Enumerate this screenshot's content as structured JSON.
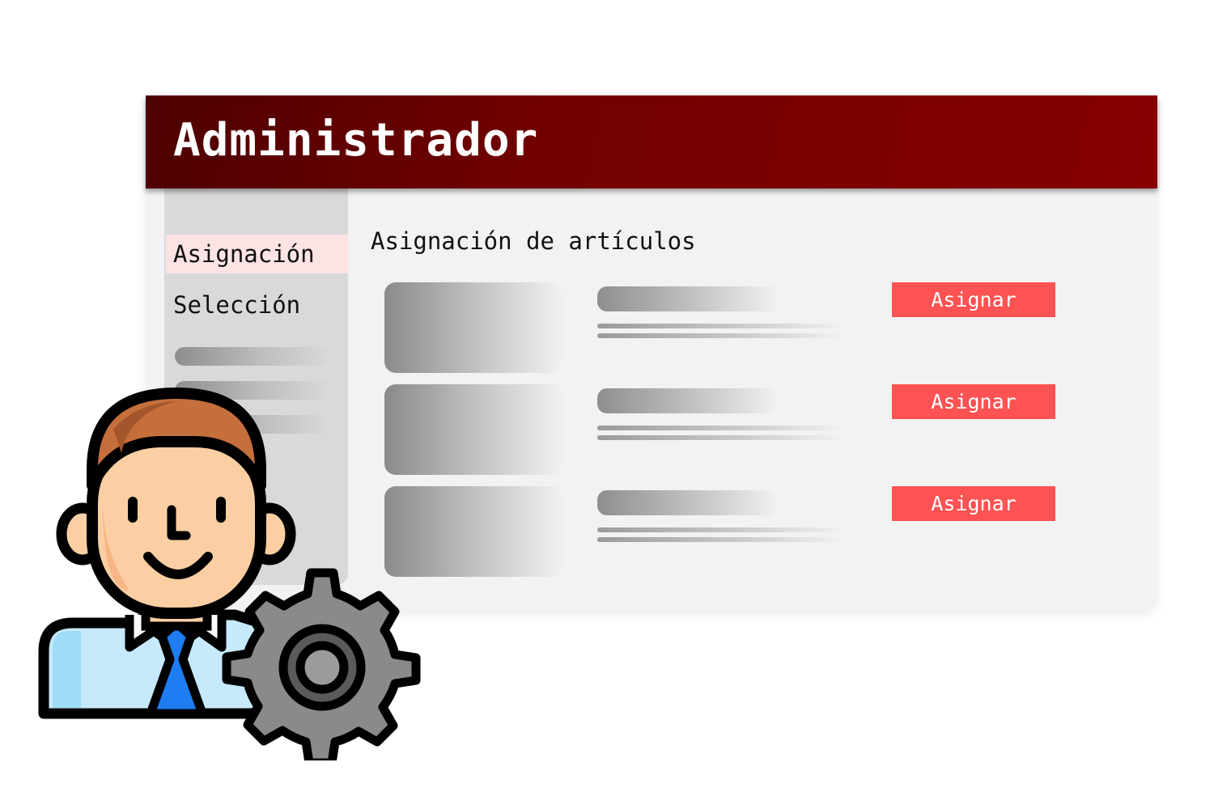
{
  "window": {
    "title": "Administrador"
  },
  "sidebar": {
    "items": [
      {
        "label": "Asignación",
        "active": true
      },
      {
        "label": "Selección",
        "active": false
      }
    ]
  },
  "main": {
    "heading": "Asignación de artículos",
    "rows": [
      {
        "button_label": "Asignar"
      },
      {
        "button_label": "Asignar"
      },
      {
        "button_label": "Asignar"
      }
    ]
  },
  "colors": {
    "header": "#780000",
    "button": "#ff5252",
    "active_nav": "#fde3e3",
    "sidebar": "#d9d9d9",
    "panel": "#f2f2f2"
  },
  "icons": {
    "avatar": "admin-user-illustration",
    "gear": "gear-icon"
  }
}
